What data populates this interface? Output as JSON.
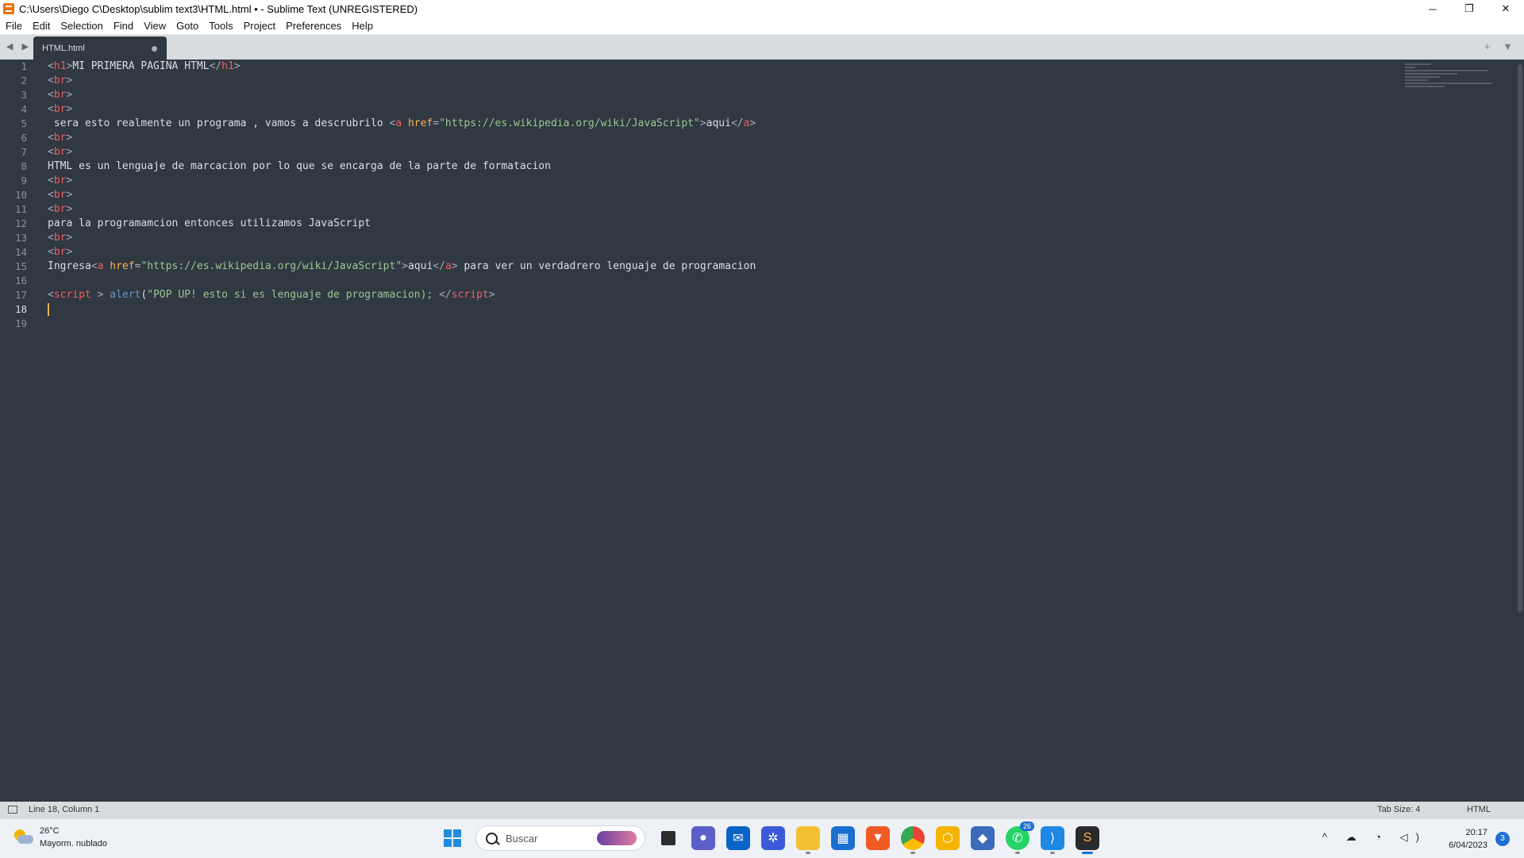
{
  "window": {
    "title": "C:\\Users\\Diego C\\Desktop\\sublim text3\\HTML.html • - Sublime Text (UNREGISTERED)",
    "controls": {
      "minimize": "─",
      "maximize": "❐",
      "close": "✕"
    }
  },
  "menu": {
    "items": [
      "File",
      "Edit",
      "Selection",
      "Find",
      "View",
      "Goto",
      "Tools",
      "Project",
      "Preferences",
      "Help"
    ]
  },
  "tabs": {
    "nav": "◀ ▶",
    "active_tab": "HTML.html",
    "tools": "+ ▼"
  },
  "editor": {
    "line_numbers": [
      "1",
      "2",
      "3",
      "4",
      "5",
      "6",
      "7",
      "8",
      "9",
      "10",
      "11",
      "12",
      "13",
      "14",
      "15",
      "16",
      "17",
      "18",
      "19"
    ],
    "active_line": 18
  },
  "status": {
    "position": "Line 18, Column 1",
    "tab_size": "Tab Size: 4",
    "syntax": "HTML"
  },
  "taskbar": {
    "weather_temp": "26°C",
    "weather_desc": "Mayorm. nublado",
    "search_placeholder": "Buscar",
    "whatsapp_badge": "26",
    "tray_icons": "^ ☁ ◔ ◁)",
    "time": "20:17",
    "date": "6/04/2023",
    "notifications": "3"
  },
  "colors": {
    "editor_bg": "#303841",
    "tag": "#ec5f66",
    "attribute": "#f9ae58",
    "string": "#99c794",
    "function": "#6699cc",
    "text": "#d8dee9"
  }
}
